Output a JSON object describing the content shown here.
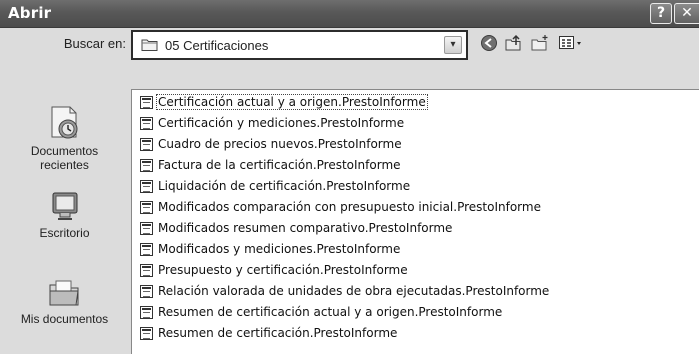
{
  "window": {
    "title": "Abrir",
    "help_glyph": "?",
    "close_glyph": "✕"
  },
  "lookin": {
    "label": "Buscar en:",
    "value": "05 Certificaciones",
    "dropdown_glyph": "▾"
  },
  "toolbar": {
    "icons": [
      "back-icon",
      "up-folder-icon",
      "new-folder-icon",
      "views-menu-icon"
    ]
  },
  "places": [
    {
      "label_line1": "Documentos",
      "label_line2": "recientes",
      "icon": "recent-documents-icon"
    },
    {
      "label_line1": "Escritorio",
      "label_line2": "",
      "icon": "desktop-icon"
    },
    {
      "label_line1": "Mis documentos",
      "label_line2": "",
      "icon": "my-documents-icon"
    }
  ],
  "files": [
    "Certificación actual y a origen.PrestoInforme",
    "Certificación y mediciones.PrestoInforme",
    "Cuadro de precios nuevos.PrestoInforme",
    "Factura de la certificación.PrestoInforme",
    "Liquidación de certificación.PrestoInforme",
    "Modificados comparación con presupuesto inicial.PrestoInforme",
    "Modificados resumen comparativo.PrestoInforme",
    "Modificados y mediciones.PrestoInforme",
    "Presupuesto y certificación.PrestoInforme",
    "Relación valorada de unidades de obra ejecutadas.PrestoInforme",
    "Resumen de certificación actual y a origen.PrestoInforme",
    "Resumen de certificación.PrestoInforme"
  ]
}
